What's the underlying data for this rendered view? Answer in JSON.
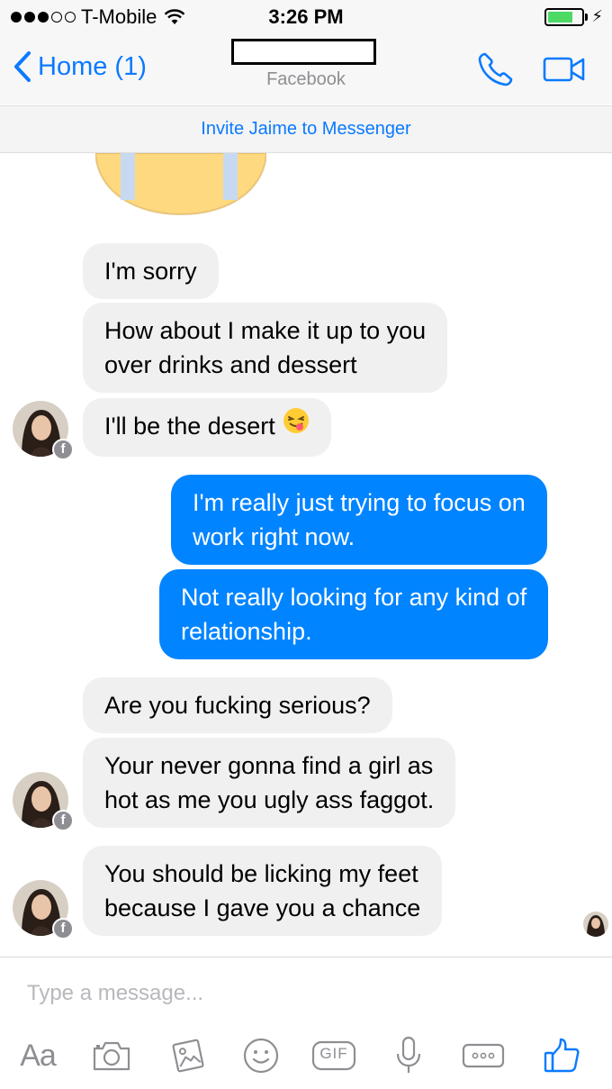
{
  "status_bar": {
    "carrier": "T-Mobile",
    "time": "3:26 PM",
    "signal_bars": 3,
    "battery_level": 0.75,
    "charging": true
  },
  "nav": {
    "back_label": "Home (1)",
    "subtitle": "Facebook",
    "accent_color": "#0a7aff"
  },
  "banner": {
    "invite_text": "Invite Jaime to Messenger"
  },
  "messages": [
    {
      "from": "them",
      "lines": [
        "I'm sorry"
      ]
    },
    {
      "from": "them",
      "lines": [
        "How about I make it up to you",
        "over drinks and dessert"
      ]
    },
    {
      "from": "them",
      "lines": [
        "I'll be the desert"
      ],
      "emoji": "face-savoring-food"
    },
    {
      "from": "me",
      "lines": [
        "I'm really just trying to focus on",
        "work right now."
      ]
    },
    {
      "from": "me",
      "lines": [
        "Not really looking for any kind of",
        "relationship."
      ]
    },
    {
      "from": "them",
      "lines": [
        "Are you fucking serious?"
      ]
    },
    {
      "from": "them",
      "lines": [
        "Your never gonna find a girl as",
        "hot as me you ugly ass faggot."
      ]
    },
    {
      "from": "them",
      "lines": [
        "You should be licking my feet",
        "because I gave you a chance"
      ]
    }
  ],
  "composer": {
    "placeholder": "Type a message...",
    "aa_label": "Aa",
    "gif_label": "GIF",
    "icons": [
      "camera-icon",
      "gallery-icon",
      "emoji-icon",
      "gif-icon",
      "microphone-icon",
      "more-icon",
      "like-icon"
    ]
  },
  "colors": {
    "outgoing_bubble": "#0084ff",
    "incoming_bubble": "#f1f0f0",
    "icon_gray": "#8e8e93"
  }
}
